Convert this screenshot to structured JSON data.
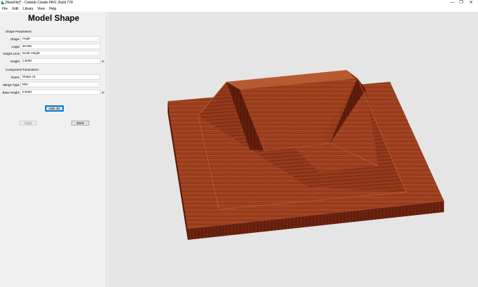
{
  "window": {
    "title": "[NewFile]* - Carbide Create PRO, Build 778",
    "controls": [
      "minimize-icon",
      "maximize-icon",
      "close-icon"
    ]
  },
  "menu": {
    "items": [
      "File",
      "Edit",
      "Library",
      "View",
      "Help"
    ]
  },
  "panel": {
    "title": "Model Shape",
    "shape_section": "Shape Parameters",
    "shape_label": "Shape",
    "shape_value": "Angle",
    "angle_label": "Angle",
    "angle_value": "30.000",
    "height_limit_label": "Height Limit",
    "height_limit_value": "Scale Height",
    "height_label": "Height",
    "height_value": "1.0000",
    "height_unit": "in",
    "component_section": "Component Parameters",
    "name_label": "Name",
    "name_value": "Shape 15",
    "merge_type_label": "Merge Type",
    "merge_type_value": "Max",
    "base_height_label": "Base Height",
    "base_height_value": "0.5000",
    "base_height_unit": "in",
    "hide_3d_label": "Hide 3D",
    "apply_label": "Apply",
    "done_label": "Done"
  },
  "colors": {
    "viewport_bg": "#e5e5e5",
    "wood_top": "#a0411f",
    "wood_side": "#6a210f",
    "focus_blue": "#0078d7"
  }
}
